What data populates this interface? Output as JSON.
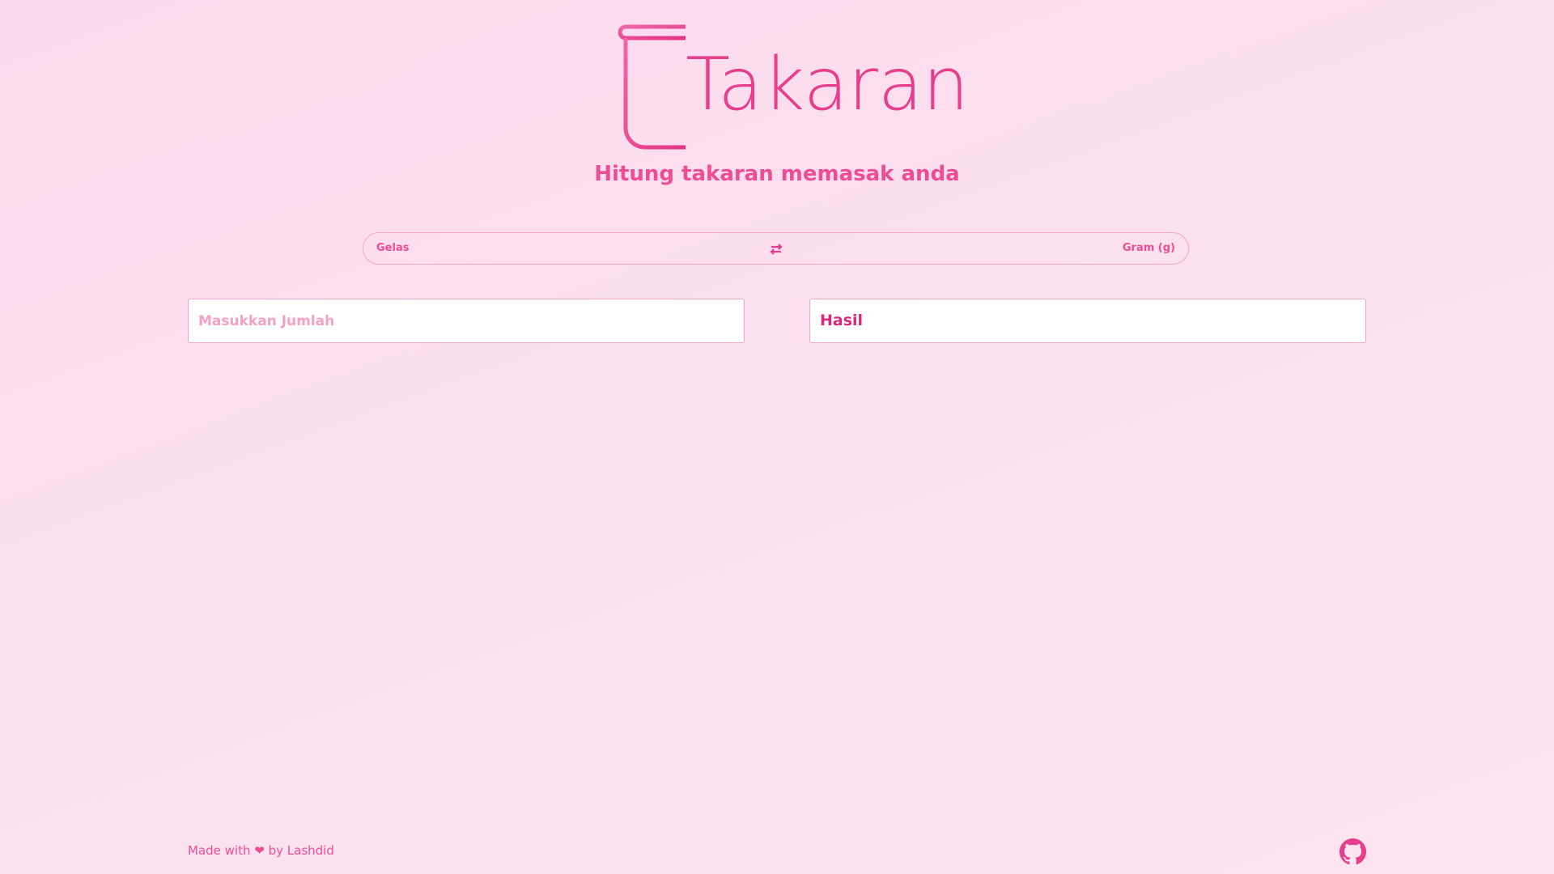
{
  "app": {
    "title": "Takaran",
    "subtitle": "Hitung takaran memasak anda"
  },
  "converter": {
    "from_unit": "Gelas",
    "to_unit": "Gram (g)",
    "swap_icon": "swap-arrows-icon",
    "amount_placeholder": "Masukkan Jumlah",
    "result_label": "Hasil"
  },
  "footer": {
    "made_with": "Made with",
    "heart": "❤",
    "by": "by Lashdid",
    "github_icon": "github-icon"
  },
  "colors": {
    "accent": "#e63e8c",
    "border": "#f6a4c9",
    "background": "#fcdaed"
  }
}
